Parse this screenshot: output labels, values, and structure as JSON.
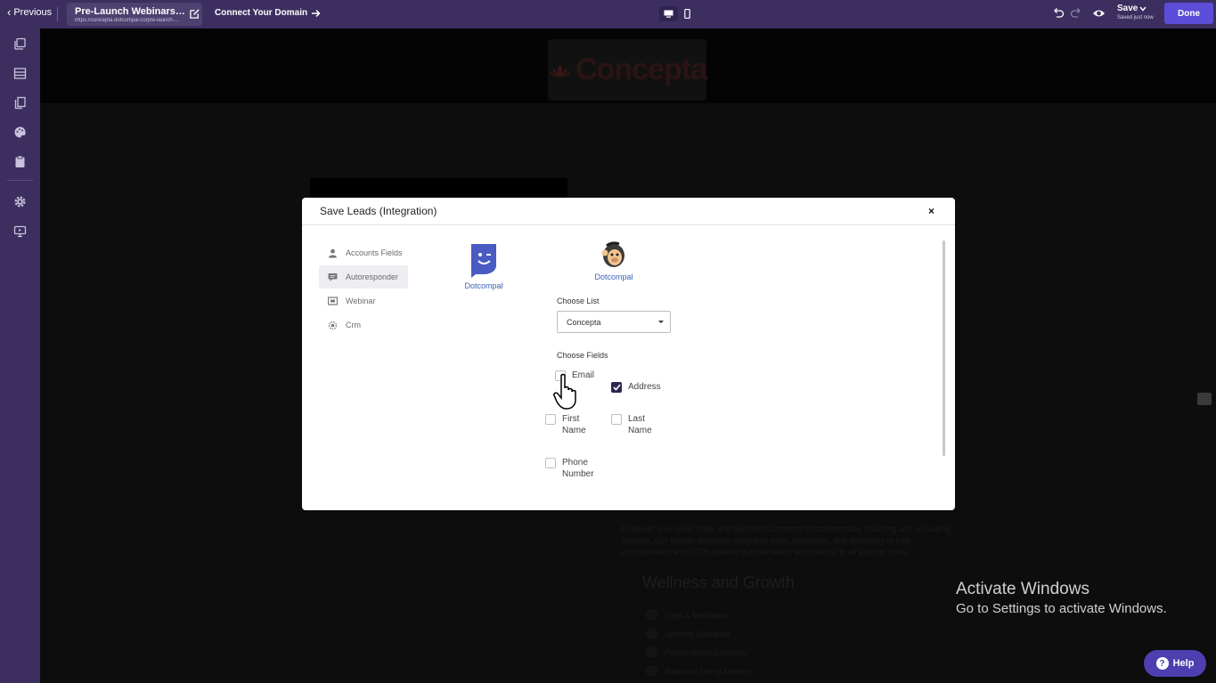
{
  "topbar": {
    "previous_label": "Previous",
    "page_title": "Pre-Launch Webinars-Pag...",
    "page_url": "https://concepta.dotcompal.co/pre-launch-...",
    "connect_label": "Connect Your Domain",
    "save_label": "Save",
    "saved_status": "Saved just now",
    "done_label": "Done"
  },
  "sidebar": {
    "items": [
      {
        "icon": "pages-icon"
      },
      {
        "icon": "sections-icon"
      },
      {
        "icon": "layers-icon"
      },
      {
        "icon": "palette-icon"
      },
      {
        "icon": "clipboard-icon"
      },
      {
        "icon": "gear-icon"
      },
      {
        "icon": "monitor-icon"
      }
    ]
  },
  "canvas": {
    "logo_text": "Concepta",
    "paragraph": "Empower your mind, body, and spirit with Concepta's transformative coaching and consulting services. Our holistic approach integrates yoga, meditation, and spirituality to help entrepreneurs and CTOs achieve optimal health and balance in all aspects of life.",
    "heading": "Wellness and Growth",
    "list": [
      "Yoga & Meditation",
      "Spiritual Guidance",
      "Personalized Coaching",
      "Balanced Living Mastery"
    ]
  },
  "modal": {
    "title": "Save Leads (Integration)",
    "close_label": "×",
    "tabs": [
      {
        "label": "Accounts Fields",
        "icon": "user-icon"
      },
      {
        "label": "Autoresponder",
        "icon": "chat-icon"
      },
      {
        "label": "Webinar",
        "icon": "webinar-icon"
      },
      {
        "label": "Crm",
        "icon": "crm-icon"
      }
    ],
    "integrations": [
      {
        "name": "Dotcompal",
        "icon": "dotcompal-logo-icon"
      },
      {
        "name": "Dotcompal",
        "icon": "mailchimp-logo-icon"
      }
    ],
    "choose_list_label": "Choose List",
    "selected_list": "Concepta",
    "choose_fields_label": "Choose Fields",
    "fields": {
      "email": {
        "label": "Email",
        "checked": false
      },
      "address": {
        "label": "Address",
        "checked": true
      },
      "first_name": {
        "label": "First Name",
        "checked": false
      },
      "last_name": {
        "label": "Last Name",
        "checked": false
      },
      "phone": {
        "label": "Phone Number",
        "checked": false
      }
    }
  },
  "overlay": {
    "activate_title": "Activate Windows",
    "activate_sub": "Go to Settings to activate Windows.",
    "help_label": "Help",
    "help_icon": "?"
  },
  "colors": {
    "topbar": "#3c2f5f",
    "accent": "#5c4dd8",
    "checkbox_checked": "#2f2550",
    "link": "#3a63b5"
  }
}
